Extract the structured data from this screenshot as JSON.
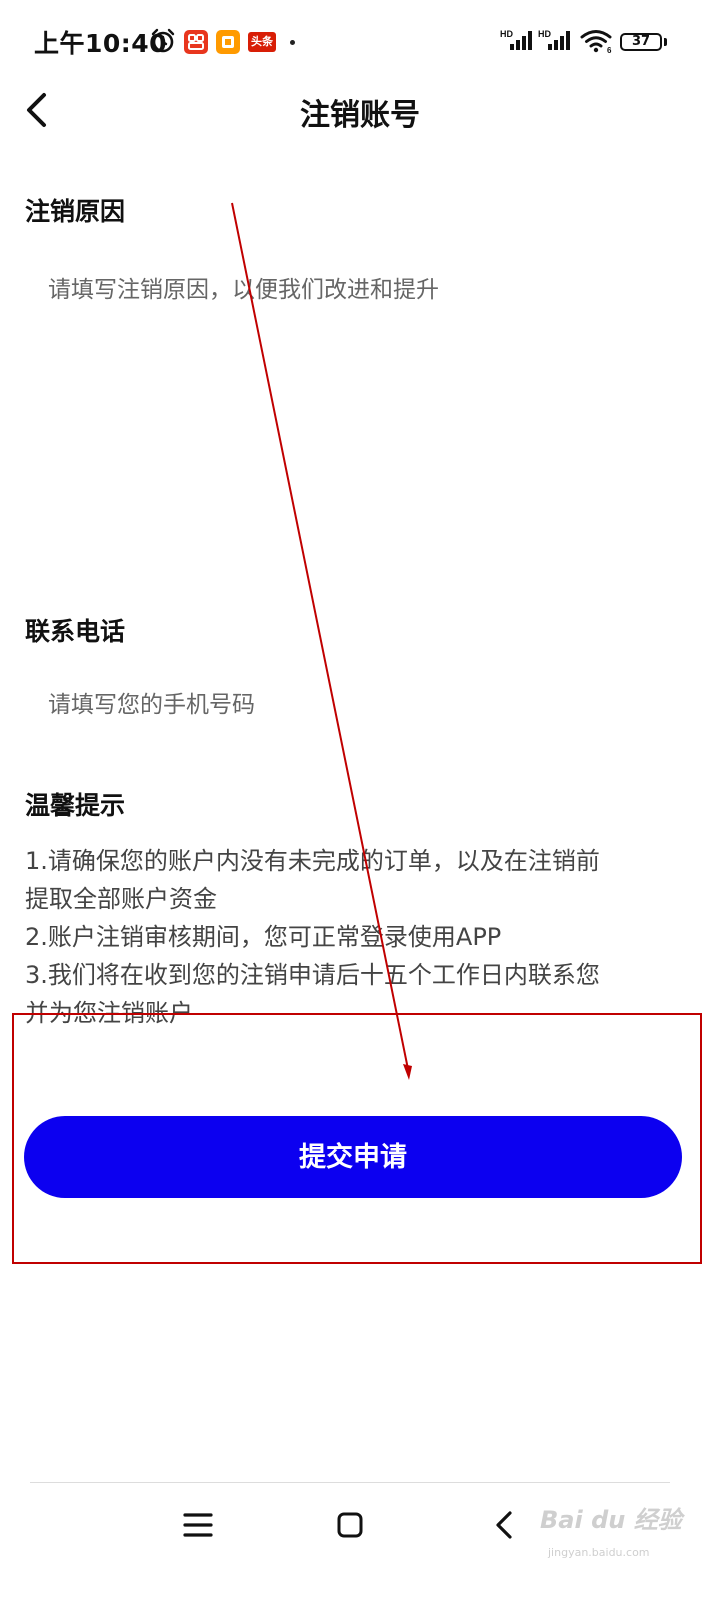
{
  "status_bar": {
    "time": "上午10:40",
    "battery": "37",
    "app_badge_text": "头条"
  },
  "header": {
    "title": "注销账号"
  },
  "reason_section": {
    "label": "注销原因",
    "placeholder": "请填写注销原因，以便我们改进和提升",
    "value": ""
  },
  "phone_section": {
    "label": "联系电话",
    "placeholder": "请填写您的手机号码",
    "value": ""
  },
  "tips_section": {
    "label": "温馨提示",
    "lines": [
      "1.请确保您的账户内没有未完成的订单，以及在注销前",
      "提取全部账户资金",
      "2.账户注销审核期间，您可正常登录使用APP",
      "3.我们将在收到您的注销申请后十五个工作日内联系您",
      "并为您注销账户"
    ]
  },
  "submit": {
    "label": "提交申请"
  },
  "colors": {
    "accent": "#0c00f0",
    "annotation": "#c00000",
    "placeholder": "#666666",
    "tips_text": "#444444"
  },
  "watermark": {
    "brand": "Bai du 经验",
    "domain": "jingyan.baidu.com"
  },
  "icons": [
    "alarm-icon",
    "signal-hd-icon",
    "wifi-icon",
    "battery-icon",
    "back-icon",
    "menu-icon",
    "home-icon",
    "nav-back-icon"
  ]
}
